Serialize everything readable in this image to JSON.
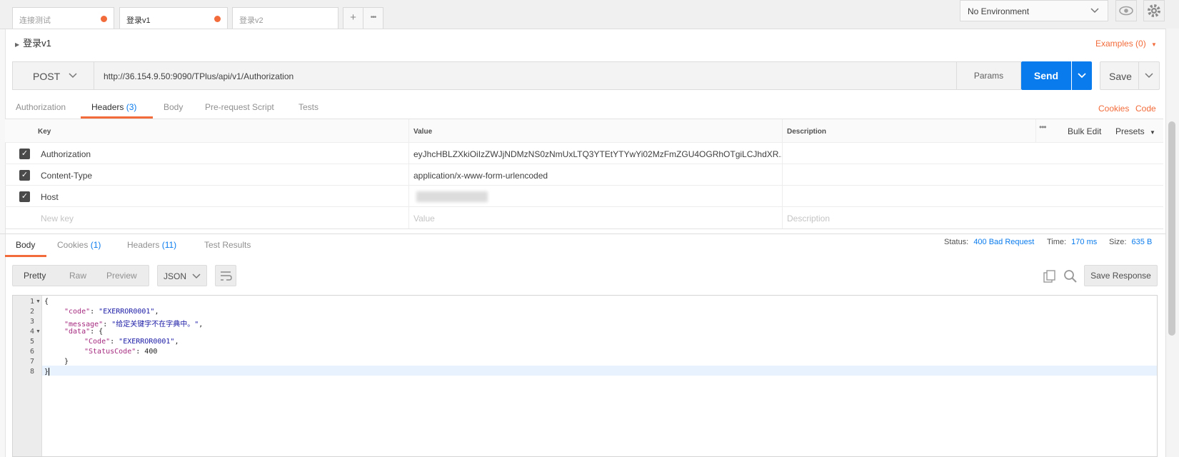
{
  "tabs": [
    {
      "label": "连接测试",
      "unsaved": true
    },
    {
      "label": "登录v1",
      "unsaved": true,
      "active": true
    },
    {
      "label": "登录v2",
      "unsaved": false
    }
  ],
  "tab_actions": {
    "new_tab": "+",
    "more": "•••"
  },
  "environment": {
    "selected": "No Environment"
  },
  "request": {
    "name": "登录v1",
    "method": "POST",
    "url": "http://36.154.9.50:9090/TPlus/api/v1/Authorization",
    "params_label": "Params",
    "send_label": "Send",
    "save_label": "Save",
    "examples_label": "Examples (0)"
  },
  "request_tabs": {
    "authorization": "Authorization",
    "headers": "Headers",
    "headers_count": "(3)",
    "body": "Body",
    "prerequest": "Pre-request Script",
    "tests": "Tests",
    "cookies_link": "Cookies",
    "code_link": "Code"
  },
  "headers_table": {
    "col_key": "Key",
    "col_value": "Value",
    "col_description": "Description",
    "bulk_edit": "Bulk Edit",
    "presets": "Presets",
    "rows": [
      {
        "key": "Authorization",
        "value": "eyJhcHBLZXkiOiIzZWJjNDMzNS0zNmUxLTQ3YTEtYTYwYi02MzFmZGU4OGRhOTgiLCJhdXR..."
      },
      {
        "key": "Content-Type",
        "value": "application/x-www-form-urlencoded"
      },
      {
        "key": "Host",
        "value": ""
      }
    ],
    "new_key_placeholder": "New key",
    "new_value_placeholder": "Value",
    "new_description_placeholder": "Description"
  },
  "response_tabs": {
    "body": "Body",
    "cookies": "Cookies",
    "cookies_count": "(1)",
    "headers": "Headers",
    "headers_count": "(11)",
    "test_results": "Test Results"
  },
  "response_status": {
    "status_label": "Status:",
    "status_value": "400 Bad Request",
    "time_label": "Time:",
    "time_value": "170 ms",
    "size_label": "Size:",
    "size_value": "635 B"
  },
  "view_modes": {
    "pretty": "Pretty",
    "raw": "Raw",
    "preview": "Preview",
    "format": "JSON"
  },
  "save_response_label": "Save Response",
  "response_body": {
    "line_numbers": [
      "1",
      "2",
      "3",
      "4",
      "5",
      "6",
      "7",
      "8"
    ],
    "brace_open": "{",
    "brace_close": "}",
    "inner_close": "}",
    "code_key": "\"code\"",
    "code_value": "\"EXERROR0001\"",
    "message_key": "\"message\"",
    "message_value": "\"给定关键字不在字典中。\"",
    "data_key": "\"data\"",
    "data_code_key": "\"Code\"",
    "data_code_value": "\"EXERROR0001\"",
    "status_code_key": "\"StatusCode\"",
    "status_code_value": "400"
  },
  "colors": {
    "accent": "#f26b3a",
    "send_blue": "#097bed"
  }
}
